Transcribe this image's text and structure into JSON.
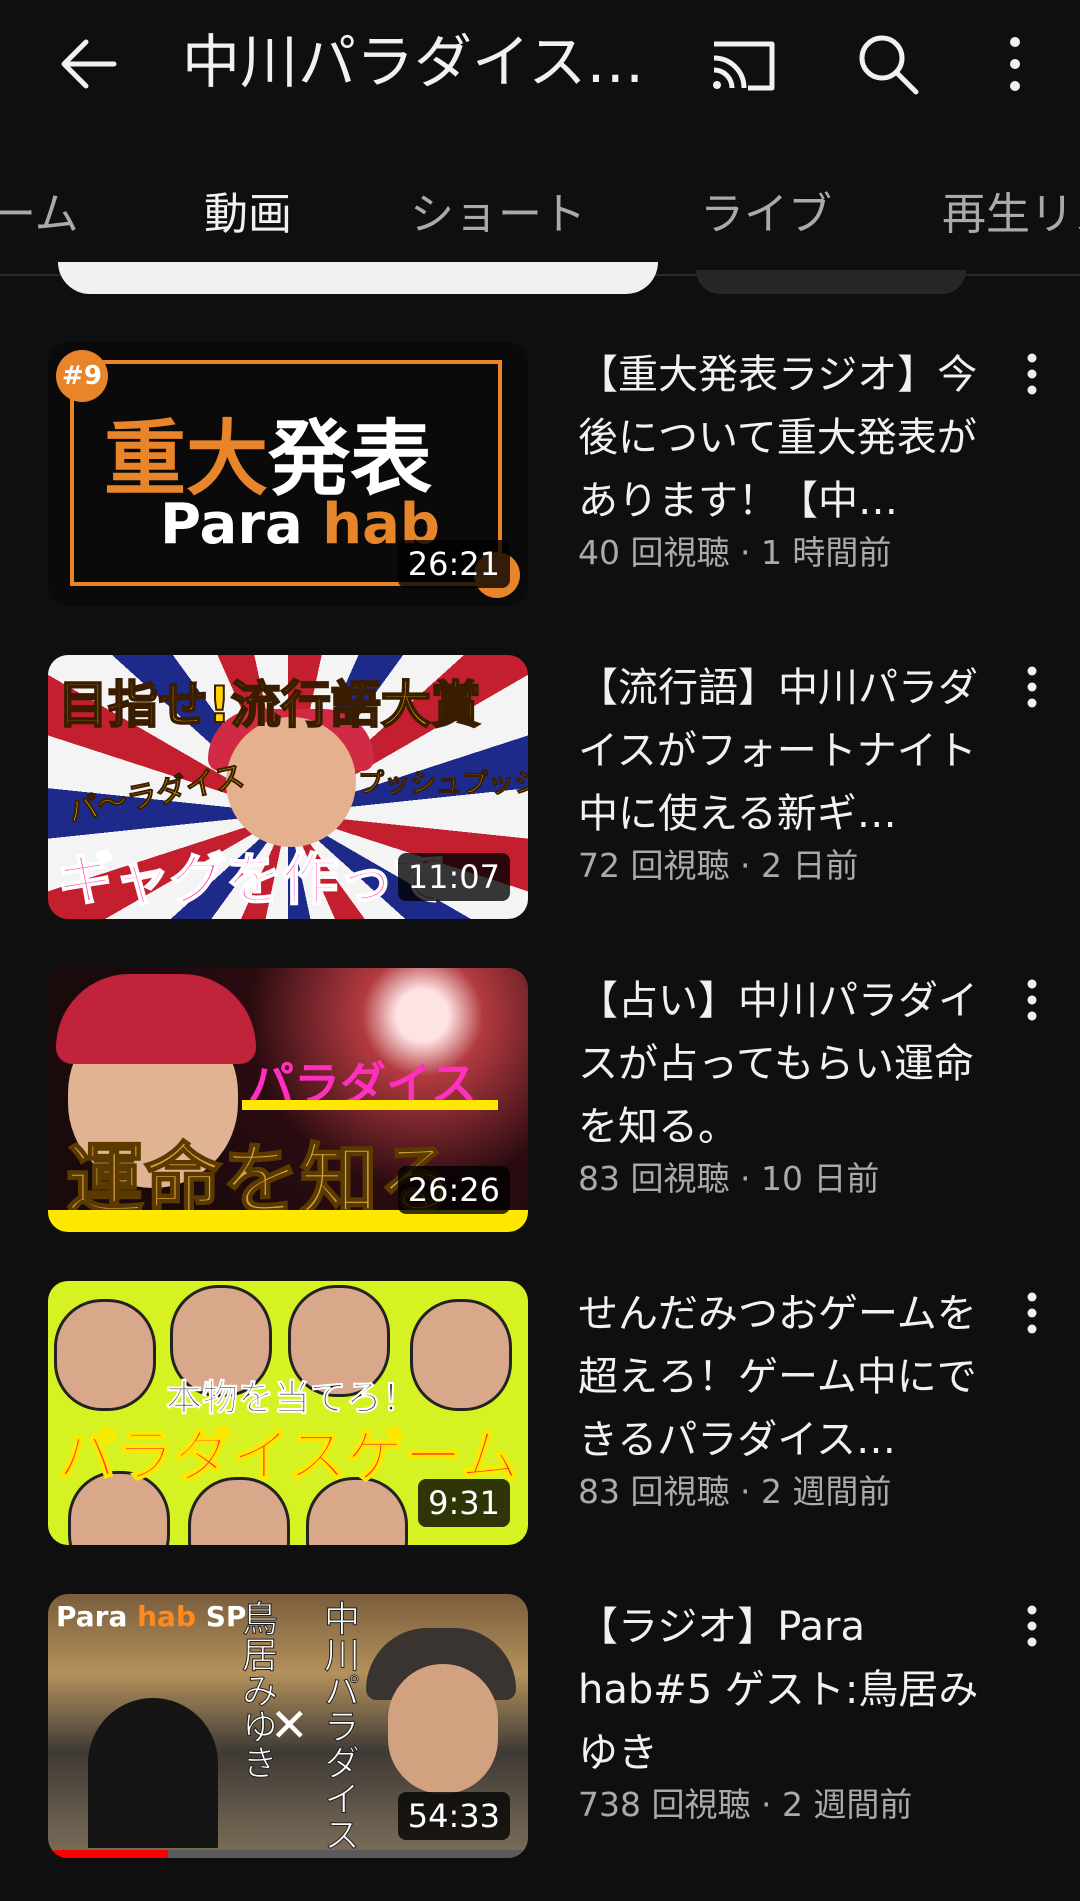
{
  "header": {
    "title": "中川パラダイス…",
    "icons": [
      "back-arrow-icon",
      "cast-icon",
      "search-icon",
      "more-vertical-icon"
    ]
  },
  "tabs": [
    {
      "label": "ーム"
    },
    {
      "label": "動画",
      "active": true
    },
    {
      "label": "ショート"
    },
    {
      "label": "ライブ"
    },
    {
      "label": "再生リス"
    }
  ],
  "videos": [
    {
      "title": "【重大発表ラジオ】今後について重大発表があります！【中…",
      "meta": "40 回視聴 · 1 時間前",
      "duration": "26:21",
      "thumb": {
        "badge": "#9",
        "text1a": "重大",
        "text1b": "発表",
        "brand_a": "Para ",
        "brand_b": "hab"
      }
    },
    {
      "title": "【流行語】中川パラダイスがフォートナイト中に使える新ギ…",
      "meta": "72 回視聴 · 2 日前",
      "duration": "11:07",
      "thumb": {
        "top": "目指せ!流行語大賞",
        "left": "パ〜ラダイス",
        "right": "プッシュプッシュ",
        "bottom": "ギャグを作って"
      }
    },
    {
      "title": "【占い】中川パラダイスが占ってもらい運命を知る。",
      "meta": "83 回視聴 · 10 日前",
      "duration": "26:26",
      "thumb": {
        "pink": "パラダイス",
        "gold": "運命を知る"
      }
    },
    {
      "title": "せんだみつおゲームを超えろ！ゲーム中にできるパラダイス…",
      "meta": "83 回視聴 · 2 週間前",
      "duration": "9:31",
      "thumb": {
        "top": "本物を当てろ！",
        "main": "パラダイスゲーム"
      }
    },
    {
      "title": "【ラジオ】Para hab#5 ゲスト:鳥居みゆき",
      "meta": "738 回視聴 · 2 週間前",
      "duration": "54:33",
      "progress": 0.25,
      "thumb": {
        "logo_a": "Para ",
        "logo_b": "hab",
        "logo_c": " SP",
        "name1": "鳥居みゆき",
        "name2": "中川パラダイス",
        "cross": "✕"
      }
    }
  ],
  "colors": {
    "background": "#0f0f0f",
    "text": "#f1f1f1",
    "secondary": "#aaaaaa",
    "accent_progress": "#ff0000"
  }
}
